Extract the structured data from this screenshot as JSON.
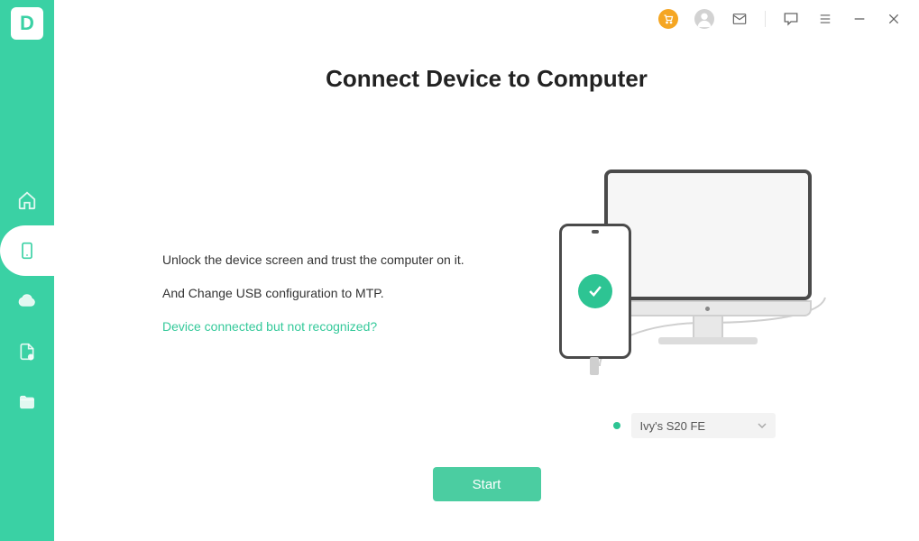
{
  "logo_letter": "D",
  "sidebar": {
    "items": [
      {
        "name": "home"
      },
      {
        "name": "device"
      },
      {
        "name": "cloud"
      },
      {
        "name": "file-alert"
      },
      {
        "name": "folder"
      }
    ]
  },
  "titlebar": {
    "icons": [
      "cart",
      "user",
      "mail",
      "feedback",
      "menu",
      "minimize",
      "close"
    ]
  },
  "page": {
    "title": "Connect Device to Computer",
    "instruction1": "Unlock the device screen and trust the computer on it.",
    "instruction2": "And Change USB configuration to MTP.",
    "help_link": "Device connected but not recognized?"
  },
  "device": {
    "status": "connected",
    "selected_name": "Ivy's S20 FE"
  },
  "actions": {
    "start_label": "Start"
  }
}
